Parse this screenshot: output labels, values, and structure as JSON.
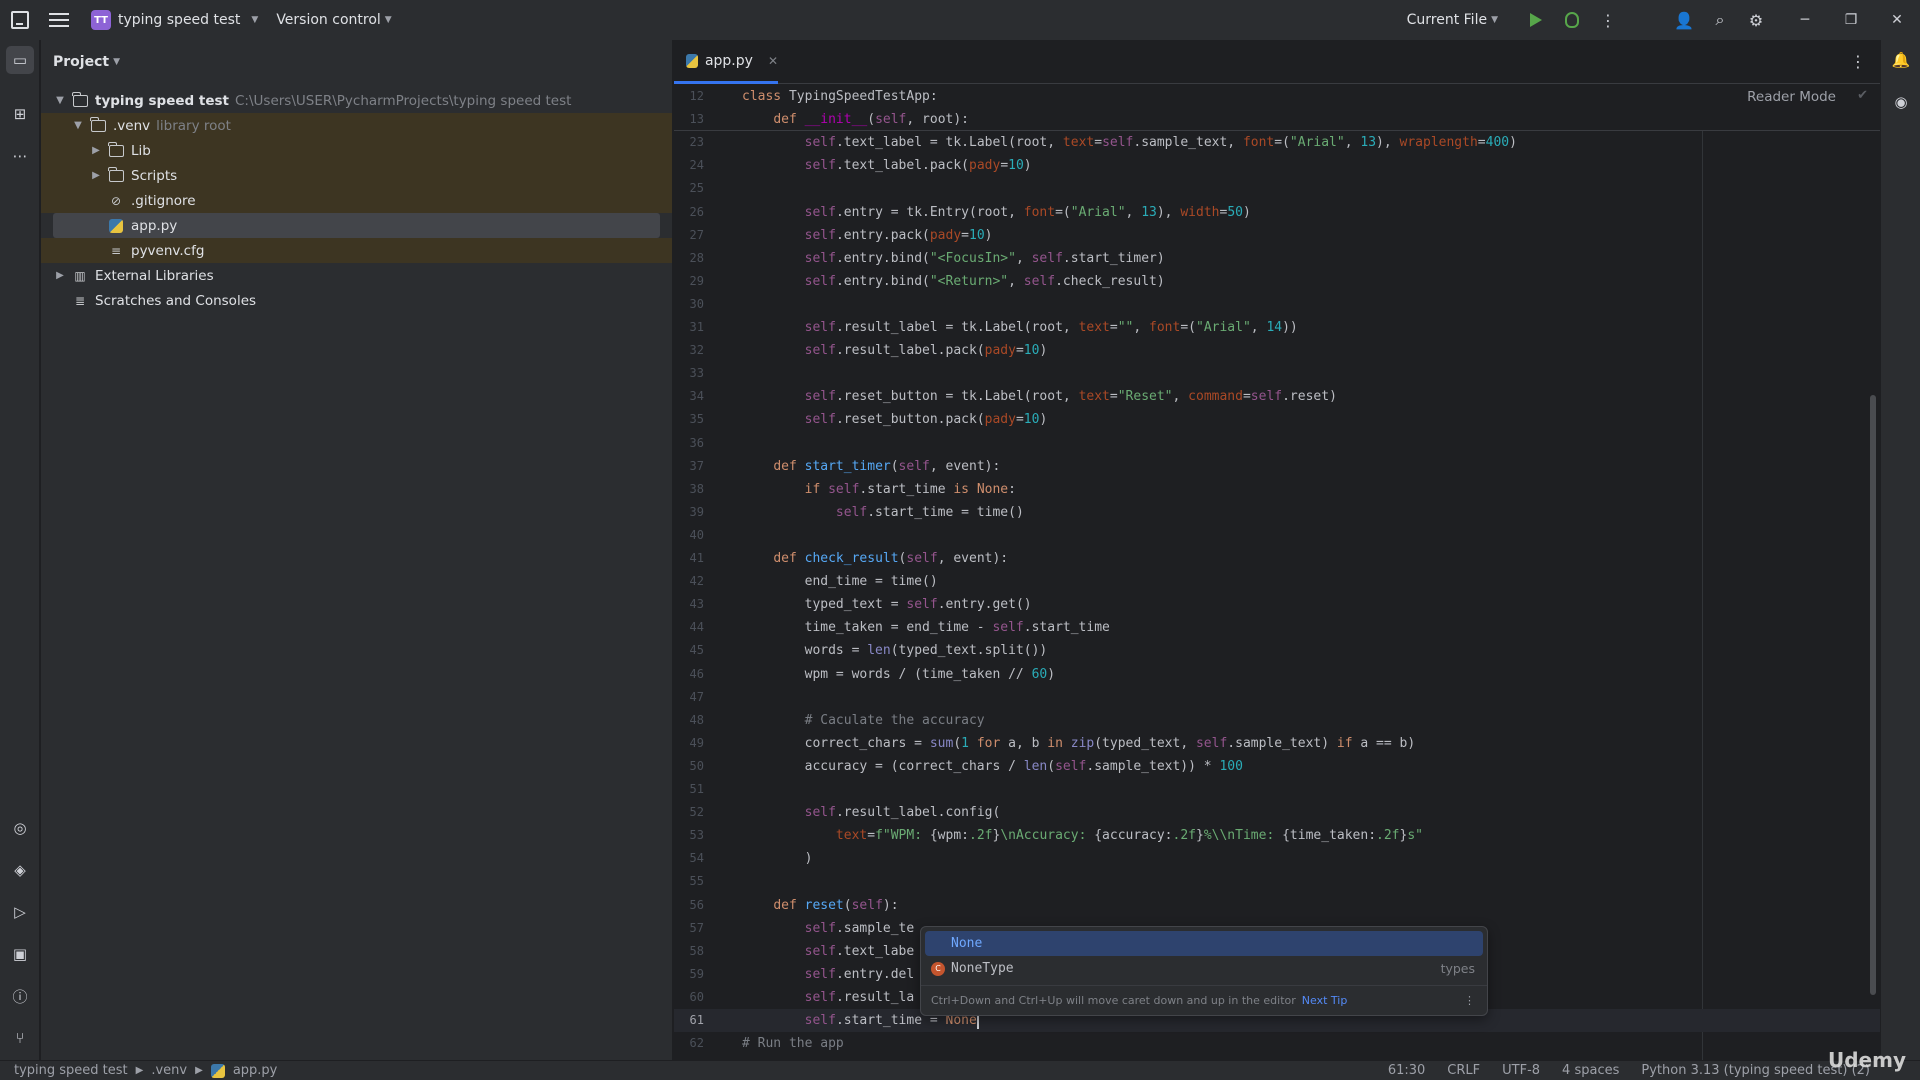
{
  "titlebar": {
    "project_badge": "TT",
    "project_name": "typing speed test",
    "version_control": "Version control",
    "run_config": "Current File"
  },
  "project_panel": {
    "title": "Project",
    "tree": [
      {
        "name": "typing speed test",
        "extra": "C:\\Users\\USER\\PycharmProjects\\typing speed test",
        "type": "folder",
        "expanded": true,
        "level": 0
      },
      {
        "name": ".venv",
        "extra": "library root",
        "type": "folder",
        "expanded": true,
        "level": 1
      },
      {
        "name": "Lib",
        "extra": "",
        "type": "folder",
        "expanded": false,
        "level": 2
      },
      {
        "name": "Scripts",
        "extra": "",
        "type": "folder",
        "expanded": false,
        "level": 2
      },
      {
        "name": ".gitignore",
        "extra": "",
        "type": "ignore-file",
        "level": 2
      },
      {
        "name": "app.py",
        "extra": "",
        "type": "python-file",
        "level": 2,
        "selected": true
      },
      {
        "name": "pyvenv.cfg",
        "extra": "",
        "type": "config-file",
        "level": 2
      },
      {
        "name": "External Libraries",
        "extra": "",
        "type": "library",
        "expanded": false,
        "level": 0
      },
      {
        "name": "Scratches and Consoles",
        "extra": "",
        "type": "scratches",
        "level": 0
      }
    ]
  },
  "editor": {
    "tab_label": "app.py",
    "reader_mode": "Reader Mode",
    "current_line": 61,
    "lines": [
      {
        "n": 12,
        "html": "<span class='kw'>class</span> TypingSpeedTestApp:"
      },
      {
        "n": 13,
        "html": "    <span class='kw'>def</span> <span class='dn'>__init__</span>(<span class='sf'>self</span>, root):"
      },
      {
        "n": 23,
        "html": "        <span class='sf'>self</span>.text_label = tk.Label(root, <span class='pr'>text</span>=<span class='sf'>self</span>.sample_text, <span class='pr'>font</span>=(<span class='st'>\"Arial\"</span>, <span class='nm'>13</span>), <span class='pr'>wraplength</span>=<span class='nm'>400</span>)"
      },
      {
        "n": 24,
        "html": "        <span class='sf'>self</span>.text_label.pack(<span class='pr'>pady</span>=<span class='nm'>10</span>)"
      },
      {
        "n": 25,
        "html": ""
      },
      {
        "n": 26,
        "html": "        <span class='sf'>self</span>.entry = tk.Entry(root, <span class='pr'>font</span>=(<span class='st'>\"Arial\"</span>, <span class='nm'>13</span>), <span class='pr'>width</span>=<span class='nm'>50</span>)"
      },
      {
        "n": 27,
        "html": "        <span class='sf'>self</span>.entry.pack(<span class='pr'>pady</span>=<span class='nm'>10</span>)"
      },
      {
        "n": 28,
        "html": "        <span class='sf'>self</span>.entry.bind(<span class='st'>\"&lt;FocusIn&gt;\"</span>, <span class='sf'>self</span>.start_timer)"
      },
      {
        "n": 29,
        "html": "        <span class='sf'>self</span>.entry.bind(<span class='st'>\"&lt;Return&gt;\"</span>, <span class='sf'>self</span>.check_result)"
      },
      {
        "n": 30,
        "html": ""
      },
      {
        "n": 31,
        "html": "        <span class='sf'>self</span>.result_label = tk.Label(root, <span class='pr'>text</span>=<span class='st'>\"\"</span>, <span class='pr'>font</span>=(<span class='st'>\"Arial\"</span>, <span class='nm'>14</span>))"
      },
      {
        "n": 32,
        "html": "        <span class='sf'>self</span>.result_label.pack(<span class='pr'>pady</span>=<span class='nm'>10</span>)"
      },
      {
        "n": 33,
        "html": ""
      },
      {
        "n": 34,
        "html": "        <span class='sf'>self</span>.reset_button = tk.Label(root, <span class='pr'>text</span>=<span class='st'>\"Reset\"</span>, <span class='pr'>command</span>=<span class='sf'>self</span>.reset)"
      },
      {
        "n": 35,
        "html": "        <span class='sf'>self</span>.reset_button.pack(<span class='pr'>pady</span>=<span class='nm'>10</span>)"
      },
      {
        "n": 36,
        "html": ""
      },
      {
        "n": 37,
        "html": "    <span class='kw'>def</span> <span class='fn'>start_timer</span>(<span class='sf'>self</span>, event):"
      },
      {
        "n": 38,
        "html": "        <span class='kw'>if</span> <span class='sf'>self</span>.start_time <span class='kw'>is</span> <span class='kw'>None</span>:"
      },
      {
        "n": 39,
        "html": "            <span class='sf'>self</span>.start_time = time()"
      },
      {
        "n": 40,
        "html": ""
      },
      {
        "n": 41,
        "html": "    <span class='kw'>def</span> <span class='fn'>check_result</span>(<span class='sf'>self</span>, event):"
      },
      {
        "n": 42,
        "html": "        end_time = time()"
      },
      {
        "n": 43,
        "html": "        typed_text = <span class='sf'>self</span>.entry.get()"
      },
      {
        "n": 44,
        "html": "        time_taken = end_time - <span class='sf'>self</span>.start_time"
      },
      {
        "n": 45,
        "html": "        words = <span class='bi'>len</span>(typed_text.split())"
      },
      {
        "n": 46,
        "html": "        wpm = words / (time_taken // <span class='nm'>60</span>)"
      },
      {
        "n": 47,
        "html": ""
      },
      {
        "n": 48,
        "html": "        <span class='cm'># Caculate the accuracy</span>"
      },
      {
        "n": 49,
        "html": "        correct_chars = <span class='bi'>sum</span>(<span class='nm'>1</span> <span class='kw'>for</span> a, b <span class='kw'>in</span> <span class='bi'>zip</span>(typed_text, <span class='sf'>self</span>.sample_text) <span class='kw'>if</span> a == b)"
      },
      {
        "n": 50,
        "html": "        accuracy = (correct_chars / <span class='bi'>len</span>(<span class='sf'>self</span>.sample_text)) * <span class='nm'>100</span>"
      },
      {
        "n": 51,
        "html": ""
      },
      {
        "n": 52,
        "html": "        <span class='sf'>self</span>.result_label.config("
      },
      {
        "n": 53,
        "html": "            <span class='pr'>text</span>=<span class='st'>f\"WPM: </span>{wpm:<span class='st'>.2f</span>}<span class='st'>\\nAccuracy: </span>{accuracy:<span class='st'>.2f</span>}<span class='st'>%\\\\nTime: </span>{time_taken:<span class='st'>.2f</span>}<span class='st'>s\"</span>"
      },
      {
        "n": 54,
        "html": "        )"
      },
      {
        "n": 55,
        "html": ""
      },
      {
        "n": 56,
        "html": "    <span class='kw'>def</span> <span class='fn'>reset</span>(<span class='sf'>self</span>):"
      },
      {
        "n": 57,
        "html": "        <span class='sf'>self</span>.sample_te"
      },
      {
        "n": 58,
        "html": "        <span class='sf'>self</span>.text_labe"
      },
      {
        "n": 59,
        "html": "        <span class='sf'>self</span>.entry.del"
      },
      {
        "n": 60,
        "html": "        <span class='sf'>self</span>.result_la"
      },
      {
        "n": 61,
        "html": "        <span class='sf'>self</span>.start_time = <span class='kw'>None</span><span class='caret'></span>"
      },
      {
        "n": 62,
        "html": "<span class='cm'># Run the app</span>"
      }
    ]
  },
  "autocomplete": {
    "items": [
      {
        "label": "None",
        "type": ""
      },
      {
        "label": "NoneType",
        "type": "types"
      }
    ],
    "tip": "Ctrl+Down and Ctrl+Up will move caret down and up in the editor",
    "next_tip": "Next Tip"
  },
  "statusbar": {
    "breadcrumb": [
      "typing speed test",
      ".venv",
      "app.py"
    ],
    "position": "61:30",
    "line_sep": "CRLF",
    "encoding": "UTF-8",
    "indent": "4 spaces",
    "interpreter": "Python 3.13 (typing speed test) (2)"
  },
  "watermark": "Udemy",
  "colors": {
    "accent": "#3574f0",
    "run": "#57a64a",
    "venv_highlight": "#3d3522"
  }
}
